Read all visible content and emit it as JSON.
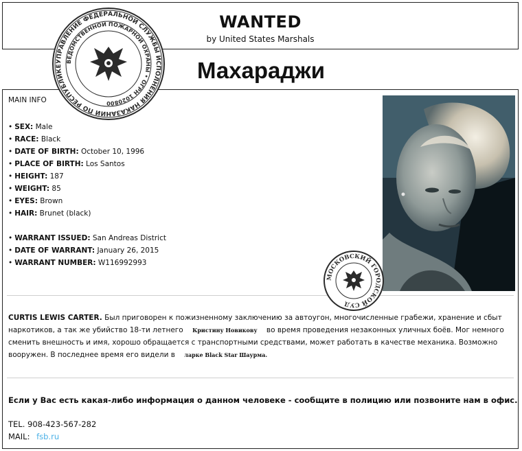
{
  "header": {
    "title": "WANTED",
    "subtitle": "by United States Marshals"
  },
  "name": "Махараджи",
  "main_info": {
    "label": "MAIN INFO",
    "items": [
      {
        "key": "SEX:",
        "value": "Male"
      },
      {
        "key": "RACE:",
        "value": "Black"
      },
      {
        "key": "DATE OF BIRTH:",
        "value": "October 10, 1996"
      },
      {
        "key": "PLACE OF BIRTH:",
        "value": "Los Santos"
      },
      {
        "key": "HEIGHT:",
        "value": "187"
      },
      {
        "key": "WEIGHT:",
        "value": "85"
      },
      {
        "key": "EYES:",
        "value": "Brown"
      },
      {
        "key": "HAIR:",
        "value": "Brunet (black)"
      }
    ],
    "warrant": [
      {
        "key": "WARRANT ISSUED:",
        "value": "San Andreas District"
      },
      {
        "key": "DATE OF WARRANT:",
        "value": "January 26, 2015"
      },
      {
        "key": "WARRANT NUMBER:",
        "value": "W116992993"
      }
    ]
  },
  "description": {
    "person": "CURTIS LEWIS CARTER.",
    "text1": "Был приговорен к пожизненному заключению за автоугон, многочисленные грабежи, хранение и сбыт наркотиков, а так же убийство 18-ти летнего",
    "victim": "Кристину Новикову",
    "text2": "во время проведения незаконных уличных боёв. Мог немного сменить внешность и имя, хорошо обращается с транспортными средствами, может работать в качестве механика. Возможно вооружен. В последнее время его видели в",
    "place": "ларке Black Star Шаурма."
  },
  "contact": {
    "request": "Если у Вас есть какая-либо информация о данном человеке - сообщите в полицию или позвоните нам в офис.",
    "tel_label": "TEL.",
    "tel": "908-423-567-282",
    "mail_label": "MAIL:",
    "mail": "fsb.ru"
  },
  "stamps": {
    "large_top": "УПРАВЛЕНИЕ ФЕДЕРАЛЬНОЙ СЛУЖБЫ ИСПОЛНЕНИЯ НАКАЗАНИЙ ПО РЕСПУБЛИКЕ КАЛМЫКИЯ",
    "large_inner": "ВЕДОМСТВЕННОЙ ПОЖАРНОЙ ОХРАНЫ • ОГРН 1020800",
    "small": "МОСКОВСКИЙ ГОРОДСКОЙ СУД"
  },
  "colors": {
    "text": "#111111",
    "link": "#4ab0e6",
    "divider": "#cfcfcf",
    "stamp": "#2b2b2b"
  }
}
